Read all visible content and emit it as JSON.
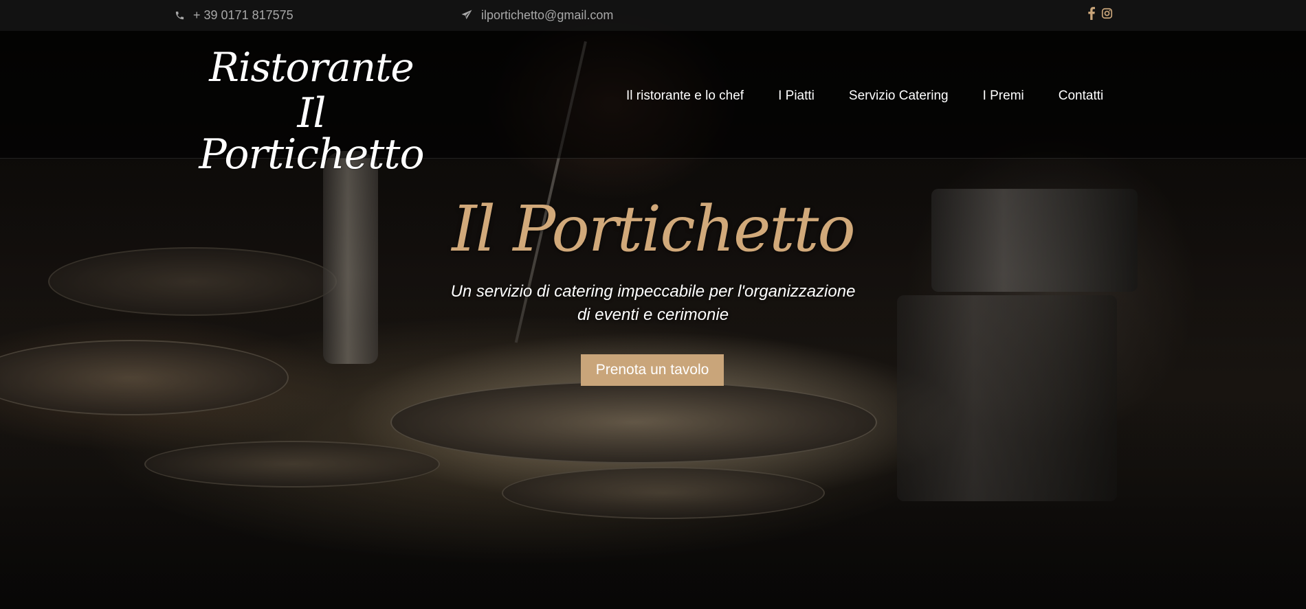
{
  "topbar": {
    "phone": "+ 39 0171 817575",
    "email": "ilportichetto@gmail.com",
    "social": [
      "facebook-icon",
      "instagram-icon"
    ]
  },
  "header": {
    "logo_line1": "Ristorante",
    "logo_line2": "Il Portichetto",
    "nav": [
      {
        "label": "Il ristorante e lo chef"
      },
      {
        "label": "I Piatti"
      },
      {
        "label": "Servizio Catering"
      },
      {
        "label": "I Premi"
      },
      {
        "label": "Contatti"
      }
    ]
  },
  "hero": {
    "title": "Il Portichetto",
    "subtitle_line1": "Un servizio di catering impeccabile per l'organizzazione",
    "subtitle_line2": "di eventi e cerimonie",
    "cta_label": "Prenota un tavolo"
  },
  "colors": {
    "accent": "#c9a57a",
    "title": "#d1a97a",
    "topbar_bg": "#141414",
    "topbar_text": "#a8a8a8"
  }
}
